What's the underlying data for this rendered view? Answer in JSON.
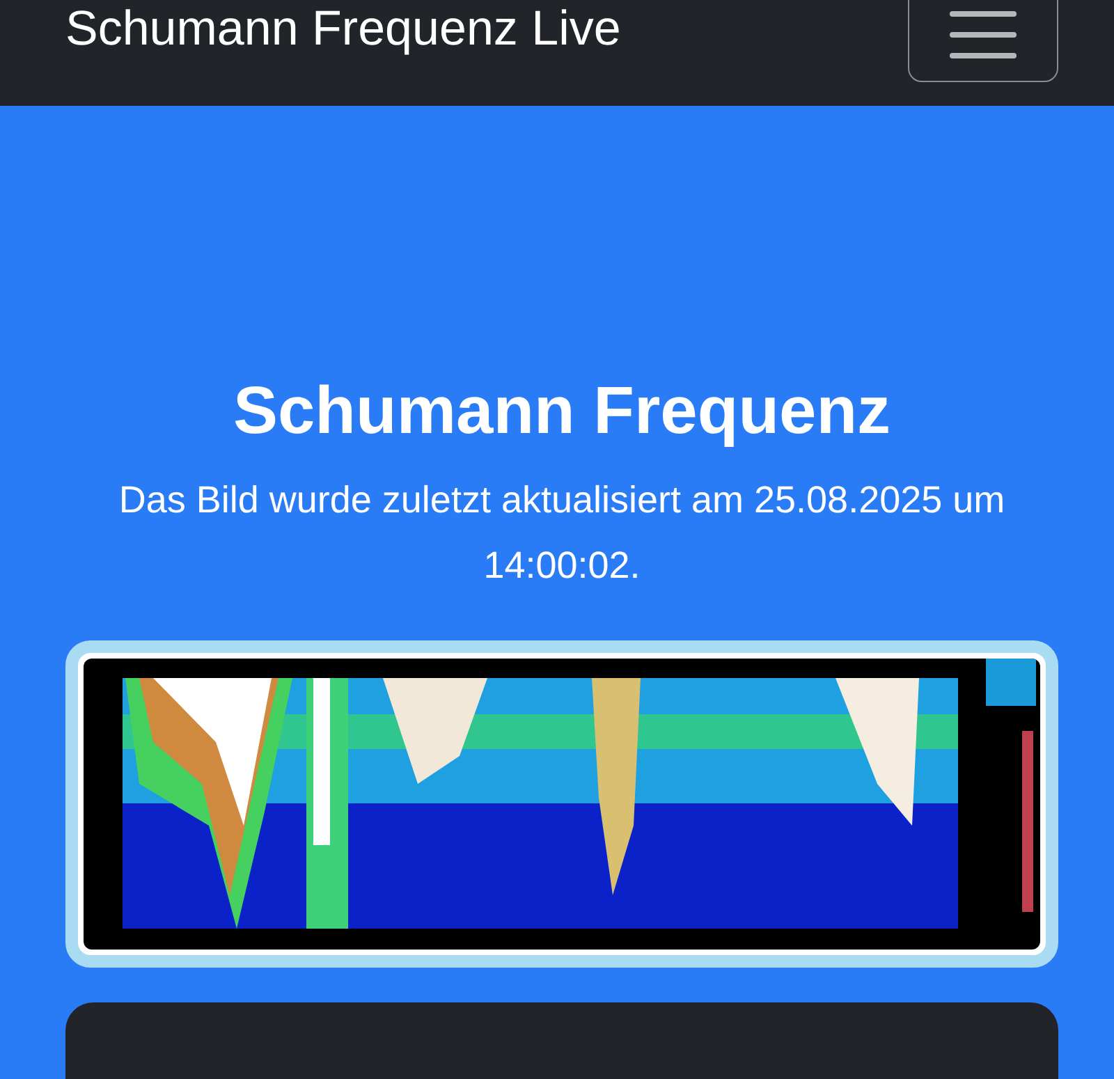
{
  "navbar": {
    "brand": "Schumann Frequenz Live"
  },
  "hero": {
    "title": "Schumann Frequenz",
    "subtitle": "Das Bild wurde zuletzt aktualisiert am 25.08.2025 um 14:00:02."
  },
  "info_card": {
    "kind": "dark"
  }
}
